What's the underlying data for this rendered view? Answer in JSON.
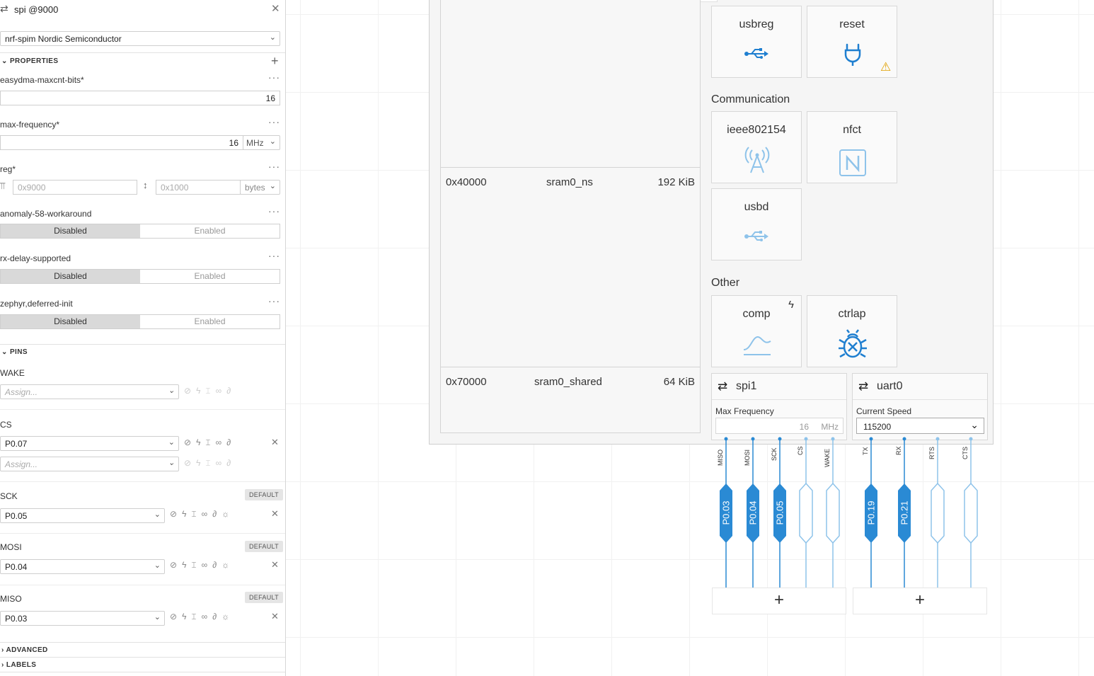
{
  "panel": {
    "title": "spi @9000",
    "compatible": "nrf-spim  Nordic Semiconductor",
    "properties_label": "PROPERTIES",
    "props": {
      "easydma": {
        "label": "easydma-maxcnt-bits*",
        "value": "16"
      },
      "maxfreq": {
        "label": "max-frequency*",
        "value": "16",
        "unit": "MHz"
      },
      "reg": {
        "label": "reg*",
        "addr_placeholder": "0x9000",
        "size_placeholder": "0x1000",
        "unit": "bytes"
      },
      "anomaly": {
        "label": "anomaly-58-workaround"
      },
      "rxdelay": {
        "label": "rx-delay-supported"
      },
      "deferred": {
        "label": "zephyr,deferred-init"
      }
    },
    "toggle": {
      "disabled": "Disabled",
      "enabled": "Enabled"
    },
    "pins_label": "PINS",
    "pins": {
      "wake": {
        "label": "WAKE",
        "placeholder": "Assign..."
      },
      "cs": {
        "label": "CS",
        "value": "P0.07",
        "placeholder": "Assign..."
      },
      "sck": {
        "label": "SCK",
        "value": "P0.05",
        "badge": "DEFAULT"
      },
      "mosi": {
        "label": "MOSI",
        "value": "P0.04",
        "badge": "DEFAULT"
      },
      "miso": {
        "label": "MISO",
        "value": "P0.03",
        "badge": "DEFAULT"
      }
    },
    "advanced_label": "ADVANCED",
    "labels_label": "LABELS"
  },
  "memory": {
    "rows": [
      {
        "addr": "0x40000",
        "name": "sram0_ns",
        "size": "192 KiB"
      },
      {
        "addr": "0x70000",
        "name": "sram0_shared",
        "size": "64 KiB"
      }
    ]
  },
  "tiles": {
    "usbreg": "usbreg",
    "reset": "reset",
    "communication": "Communication",
    "ieee": "ieee802154",
    "nfct": "nfct",
    "usbd": "usbd",
    "other": "Other",
    "comp": "comp",
    "ctrlap": "ctrlap"
  },
  "spi1": {
    "title": "spi1",
    "label": "Max Frequency",
    "value": "16",
    "unit": "MHz",
    "pins": [
      "MISO",
      "MOSI",
      "SCK",
      "CS",
      "WAKE"
    ],
    "assigned": [
      "P0.03",
      "P0.04",
      "P0.05"
    ]
  },
  "uart0": {
    "title": "uart0",
    "label": "Current Speed",
    "value": "115200",
    "pins": [
      "TX",
      "RX",
      "RTS",
      "CTS"
    ],
    "assigned": [
      "P0.19",
      "P0.21"
    ]
  },
  "add_symbol": "+",
  "colors": {
    "accent": "#1f7fd0",
    "pin_fill": "#2a8ad4",
    "pin_light": "#8ec3ea"
  }
}
